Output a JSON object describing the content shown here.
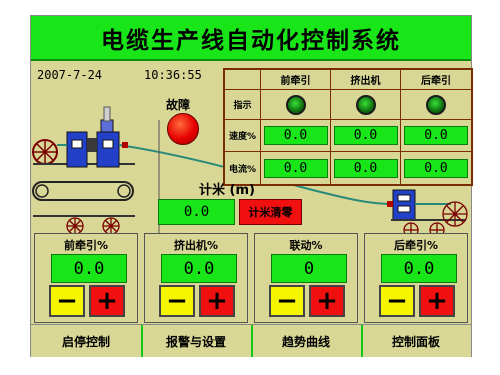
{
  "title": "电缆生产线自动化控制系统",
  "status_bar": {
    "date": "2007-7-24",
    "time": "10:36:55"
  },
  "fault": {
    "label": "故障",
    "lamp_color": "#e60000"
  },
  "table": {
    "headers": [
      "前牵引",
      "挤出机",
      "后牵引"
    ],
    "rows": [
      {
        "label": "指示",
        "values": [
          "",
          "",
          ""
        ]
      },
      {
        "label": "速度%",
        "values": [
          "0.0",
          "0.0",
          "0.0"
        ]
      },
      {
        "label": "电流%",
        "values": [
          "0.0",
          "0.0",
          "0.0"
        ]
      }
    ]
  },
  "meter": {
    "label": "计米 (m)",
    "value": "0.0",
    "reset_label": "计米清零"
  },
  "panels": [
    {
      "label": "前牵引%",
      "value": "0.0",
      "minus": "−",
      "plus": "+"
    },
    {
      "label": "挤出机%",
      "value": "0.0",
      "minus": "−",
      "plus": "+"
    },
    {
      "label": "联动%",
      "value": "0",
      "minus": "−",
      "plus": "+"
    },
    {
      "label": "后牵引%",
      "value": "0.0",
      "minus": "−",
      "plus": "+"
    }
  ],
  "nav": [
    "启停控制",
    "报警与设置",
    "趋势曲线",
    "控制面板"
  ],
  "colors": {
    "accent_green": "#19e619",
    "background": "#d8d796",
    "fault_red": "#e60000",
    "button_yellow": "#f5f500"
  }
}
